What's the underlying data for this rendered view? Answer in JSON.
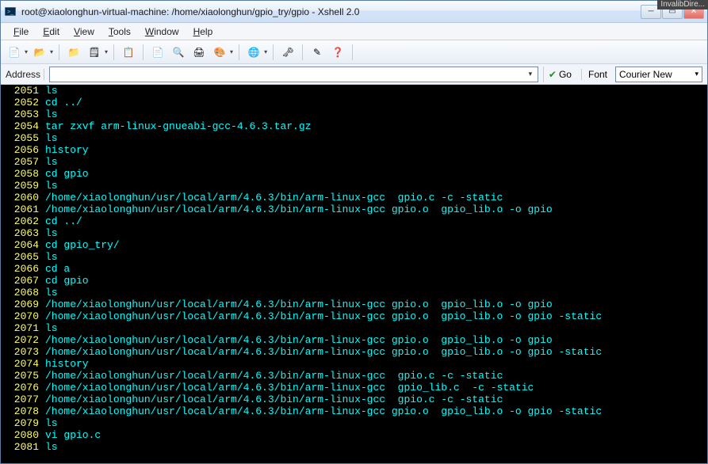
{
  "top_tag": "InvalibDire...",
  "title": "root@xiaolonghun-virtual-machine: /home/xiaolonghun/gpio_try/gpio - Xshell 2.0",
  "menu": {
    "file": "File",
    "edit": "Edit",
    "view": "View",
    "tools": "Tools",
    "window": "Window",
    "help": "Help"
  },
  "toolbar_icons": [
    {
      "name": "new-session-icon",
      "glyph": "📄"
    },
    {
      "name": "open-icon",
      "glyph": "📂"
    },
    {
      "name": "save-icon",
      "glyph": "📁"
    },
    {
      "name": "properties-icon",
      "glyph": "🗒"
    },
    {
      "name": "copy-icon",
      "glyph": "📋"
    },
    {
      "name": "paste-icon",
      "glyph": "📄"
    },
    {
      "name": "find-icon",
      "glyph": "🔍"
    },
    {
      "name": "print-icon",
      "glyph": "🖨"
    },
    {
      "name": "color-icon",
      "glyph": "🎨"
    },
    {
      "name": "globe-icon",
      "glyph": "🌐"
    },
    {
      "name": "key-icon",
      "glyph": "🗝"
    },
    {
      "name": "edit-icon",
      "glyph": "✎"
    },
    {
      "name": "help-icon",
      "glyph": "❓"
    }
  ],
  "addressbar": {
    "label": "Address",
    "value": "",
    "go": "Go",
    "font_label": "Font",
    "font_value": "Courier New"
  },
  "history": [
    {
      "n": "2051",
      "c": "ls"
    },
    {
      "n": "2052",
      "c": "cd ../"
    },
    {
      "n": "2053",
      "c": "ls"
    },
    {
      "n": "2054",
      "c": "tar zxvf arm-linux-gnueabi-gcc-4.6.3.tar.gz"
    },
    {
      "n": "2055",
      "c": "ls"
    },
    {
      "n": "2056",
      "c": "history"
    },
    {
      "n": "2057",
      "c": "ls"
    },
    {
      "n": "2058",
      "c": "cd gpio"
    },
    {
      "n": "2059",
      "c": "ls"
    },
    {
      "n": "2060",
      "c": "/home/xiaolonghun/usr/local/arm/4.6.3/bin/arm-linux-gcc  gpio.c -c -static"
    },
    {
      "n": "2061",
      "c": "/home/xiaolonghun/usr/local/arm/4.6.3/bin/arm-linux-gcc gpio.o  gpio_lib.o -o gpio"
    },
    {
      "n": "2062",
      "c": "cd ../"
    },
    {
      "n": "2063",
      "c": "ls"
    },
    {
      "n": "2064",
      "c": "cd gpio_try/"
    },
    {
      "n": "2065",
      "c": "ls"
    },
    {
      "n": "2066",
      "c": "cd a"
    },
    {
      "n": "2067",
      "c": "cd gpio"
    },
    {
      "n": "2068",
      "c": "ls"
    },
    {
      "n": "2069",
      "c": "/home/xiaolonghun/usr/local/arm/4.6.3/bin/arm-linux-gcc gpio.o  gpio_lib.o -o gpio"
    },
    {
      "n": "2070",
      "c": "/home/xiaolonghun/usr/local/arm/4.6.3/bin/arm-linux-gcc gpio.o  gpio_lib.o -o gpio -static"
    },
    {
      "n": "2071",
      "c": "ls"
    },
    {
      "n": "2072",
      "c": "/home/xiaolonghun/usr/local/arm/4.6.3/bin/arm-linux-gcc gpio.o  gpio_lib.o -o gpio"
    },
    {
      "n": "2073",
      "c": "/home/xiaolonghun/usr/local/arm/4.6.3/bin/arm-linux-gcc gpio.o  gpio_lib.o -o gpio -static"
    },
    {
      "n": "2074",
      "c": "history"
    },
    {
      "n": "2075",
      "c": "/home/xiaolonghun/usr/local/arm/4.6.3/bin/arm-linux-gcc  gpio.c -c -static"
    },
    {
      "n": "2076",
      "c": "/home/xiaolonghun/usr/local/arm/4.6.3/bin/arm-linux-gcc  gpio_lib.c  -c -static"
    },
    {
      "n": "2077",
      "c": "/home/xiaolonghun/usr/local/arm/4.6.3/bin/arm-linux-gcc  gpio.c -c -static"
    },
    {
      "n": "2078",
      "c": "/home/xiaolonghun/usr/local/arm/4.6.3/bin/arm-linux-gcc gpio.o  gpio_lib.o -o gpio -static"
    },
    {
      "n": "2079",
      "c": "ls"
    },
    {
      "n": "2080",
      "c": "vi gpio.c"
    },
    {
      "n": "2081",
      "c": "ls"
    }
  ]
}
